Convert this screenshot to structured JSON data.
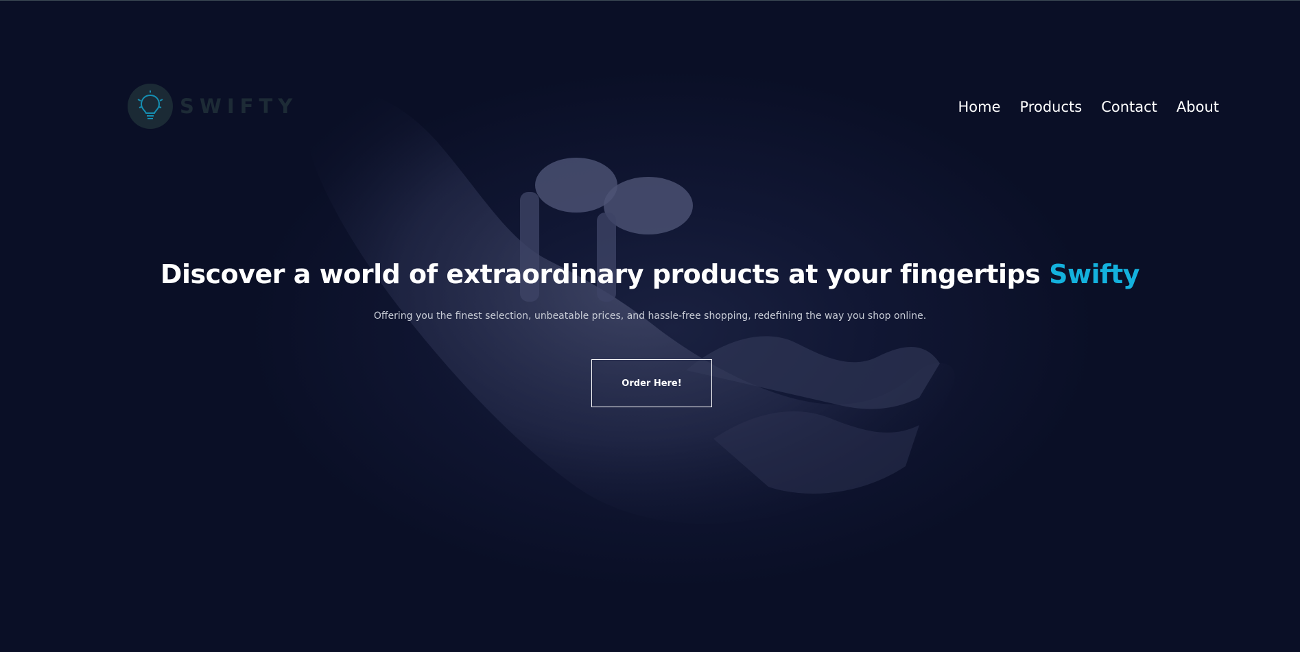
{
  "brand": {
    "name": "SWIFTY",
    "icon": "lightbulb-icon",
    "accent_color": "#14b1dd"
  },
  "nav": {
    "items": [
      {
        "label": "Home"
      },
      {
        "label": "Products"
      },
      {
        "label": "Contact"
      },
      {
        "label": "About"
      }
    ]
  },
  "hero": {
    "title": "Discover a world of extraordinary products at your fingertips",
    "title_accent": "Swifty",
    "subtitle": "Offering you the finest selection, unbeatable prices, and hassle-free shopping, redefining the way you shop online.",
    "cta_label": "Order Here!"
  },
  "colors": {
    "background": "#0a0f26",
    "text": "#ffffff",
    "accent": "#14b1dd"
  }
}
